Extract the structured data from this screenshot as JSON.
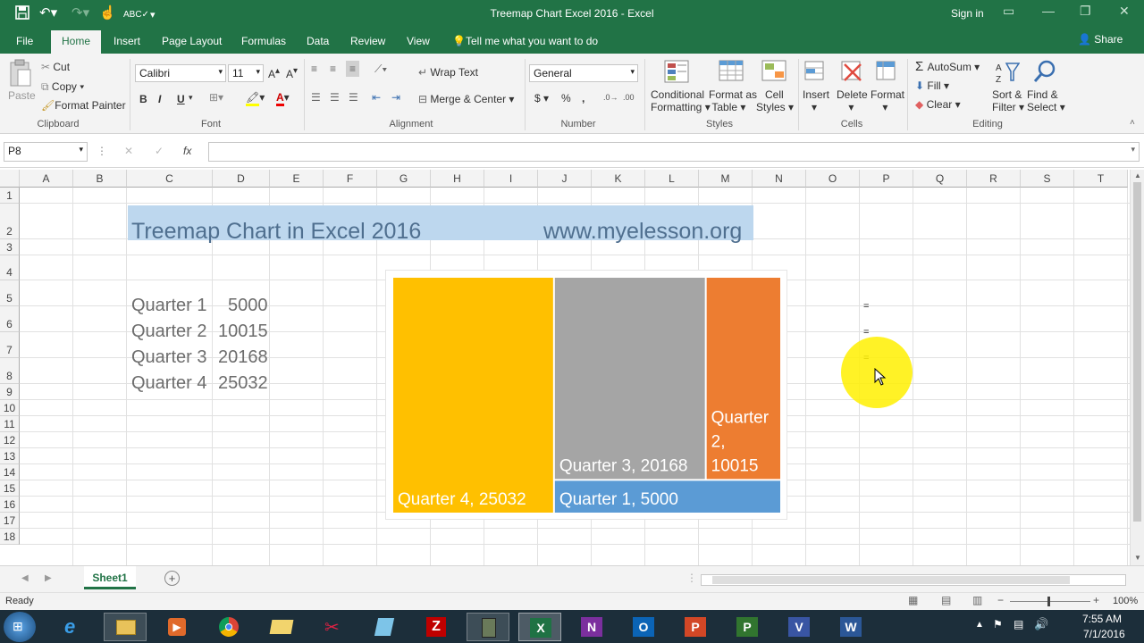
{
  "window": {
    "title": "Treemap Chart Excel 2016 - Excel",
    "signin": "Sign in"
  },
  "tabs": {
    "file": "File",
    "home": "Home",
    "insert": "Insert",
    "page_layout": "Page Layout",
    "formulas": "Formulas",
    "data": "Data",
    "review": "Review",
    "view": "View",
    "tell_me": "Tell me what you want to do",
    "share": "Share"
  },
  "ribbon": {
    "clipboard": {
      "label": "Clipboard",
      "paste": "Paste",
      "cut": "Cut",
      "copy": "Copy",
      "format_painter": "Format Painter"
    },
    "font": {
      "label": "Font",
      "name": "Calibri",
      "size": "11",
      "bold": "B",
      "italic": "I",
      "underline": "U"
    },
    "alignment": {
      "label": "Alignment",
      "wrap_text": "Wrap Text",
      "merge_center": "Merge & Center"
    },
    "number": {
      "label": "Number",
      "format": "General",
      "currency": "$",
      "percent": "%",
      "comma": ","
    },
    "styles": {
      "label": "Styles",
      "conditional_1": "Conditional",
      "conditional_2": "Formatting",
      "format_table_1": "Format as",
      "format_table_2": "Table",
      "cell_styles_1": "Cell",
      "cell_styles_2": "Styles"
    },
    "cells": {
      "label": "Cells",
      "insert": "Insert",
      "delete": "Delete",
      "format": "Format"
    },
    "editing": {
      "label": "Editing",
      "autosum": "AutoSum",
      "fill": "Fill",
      "clear": "Clear",
      "sort_1": "Sort &",
      "sort_2": "Filter",
      "find_1": "Find &",
      "find_2": "Select"
    }
  },
  "formula_bar": {
    "name_box": "P8",
    "fx": "fx",
    "cancel": "✕",
    "enter": "✓",
    "content": ""
  },
  "columns": [
    "A",
    "B",
    "C",
    "D",
    "E",
    "F",
    "G",
    "H",
    "I",
    "J",
    "K",
    "L",
    "M",
    "N",
    "O",
    "P",
    "Q",
    "R",
    "S",
    "T"
  ],
  "rows": [
    "1",
    "2",
    "3",
    "4",
    "5",
    "6",
    "7",
    "8",
    "9",
    "10",
    "11",
    "12",
    "13",
    "14",
    "15",
    "16",
    "17",
    "18"
  ],
  "cells": {
    "title": "Treemap Chart in Excel 2016",
    "website": "www.myelesson.org",
    "q1_label": "Quarter 1",
    "q1_value": "5000",
    "q2_label": "Quarter 2",
    "q2_value": "10015",
    "q3_label": "Quarter 3",
    "q3_value": "20168",
    "q4_label": "Quarter 4",
    "q4_value": "25032",
    "p5": "=",
    "p6": "=",
    "p7": "="
  },
  "chart_data": {
    "type": "treemap",
    "title": "",
    "items": [
      {
        "name": "Quarter 4",
        "value": 25032,
        "label": "Quarter 4, 25032",
        "color": "#ffc000"
      },
      {
        "name": "Quarter 3",
        "value": 20168,
        "label": "Quarter 3, 20168",
        "color": "#a5a5a5"
      },
      {
        "name": "Quarter 2",
        "value": 10015,
        "label_lines": [
          "Quarter",
          "2,",
          "10015"
        ],
        "color": "#ed7d31"
      },
      {
        "name": "Quarter 1",
        "value": 5000,
        "label": "Quarter 1, 5000",
        "color": "#5b9bd5"
      }
    ]
  },
  "sheet_tabs": {
    "active": "Sheet1",
    "add": "+"
  },
  "status": {
    "ready": "Ready",
    "zoom": "100%"
  },
  "taskbar": {
    "time": "7:55 AM",
    "date": "7/1/2016"
  },
  "colors": {
    "excel_green": "#217346",
    "header_fill": "#bdd7ee"
  }
}
